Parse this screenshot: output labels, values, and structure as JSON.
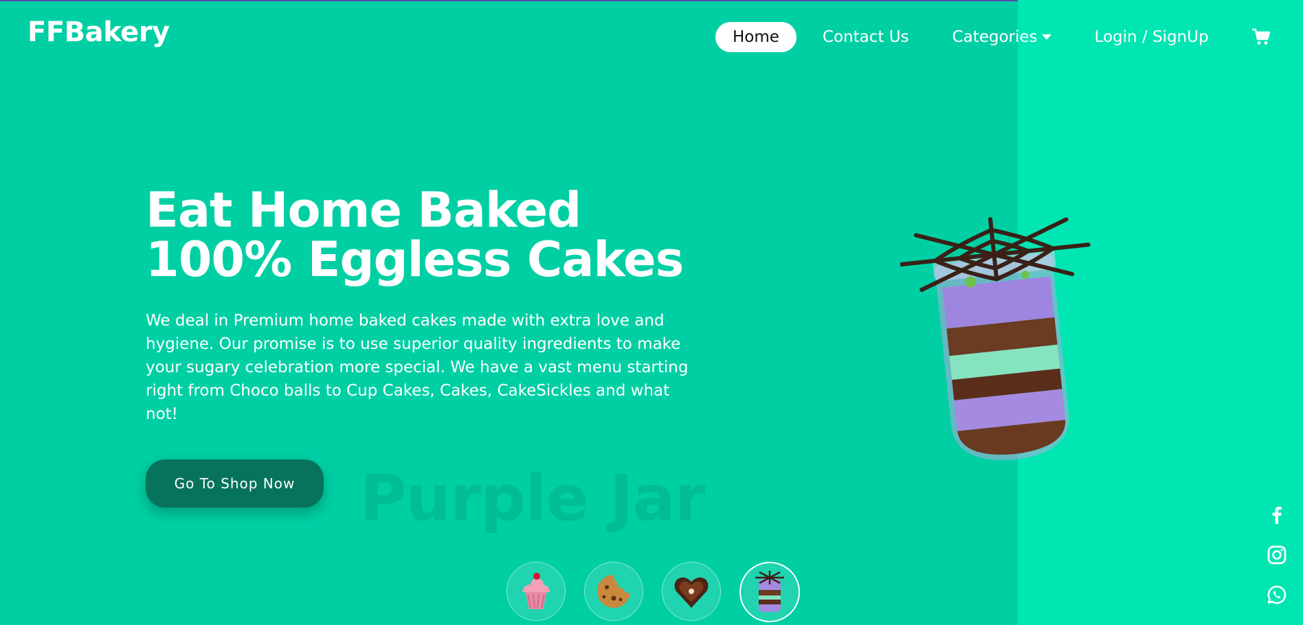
{
  "brand": {
    "name": "FFBakery"
  },
  "nav": {
    "home": "Home",
    "contact": "Contact Us",
    "categories": "Categories",
    "login": "Login / SignUp",
    "cart_icon": "shopping-cart-icon"
  },
  "hero": {
    "title": "Eat Home Baked 100% Eggless Cakes",
    "description": "We deal in Premium home baked cakes made with extra love and hygiene. Our promise is to use superior quality ingredients to make your sugary celebration more special. We have a vast menu starting right from Choco balls to Cup Cakes, Cakes, CakeSickles and what not!",
    "cta": "Go To Shop Now",
    "product_name": "Purple Jar"
  },
  "products": [
    {
      "icon": "cupcake-icon",
      "active": false
    },
    {
      "icon": "cookie-icon",
      "active": false
    },
    {
      "icon": "heart-cake-icon",
      "active": false
    },
    {
      "icon": "purple-jar-icon",
      "active": true
    }
  ],
  "social": [
    "facebook-icon",
    "instagram-icon",
    "whatsapp-icon"
  ],
  "colors": {
    "background": "#00cfa4",
    "panel": "#00e6b2",
    "button": "#08735c",
    "text": "#ffffff"
  }
}
